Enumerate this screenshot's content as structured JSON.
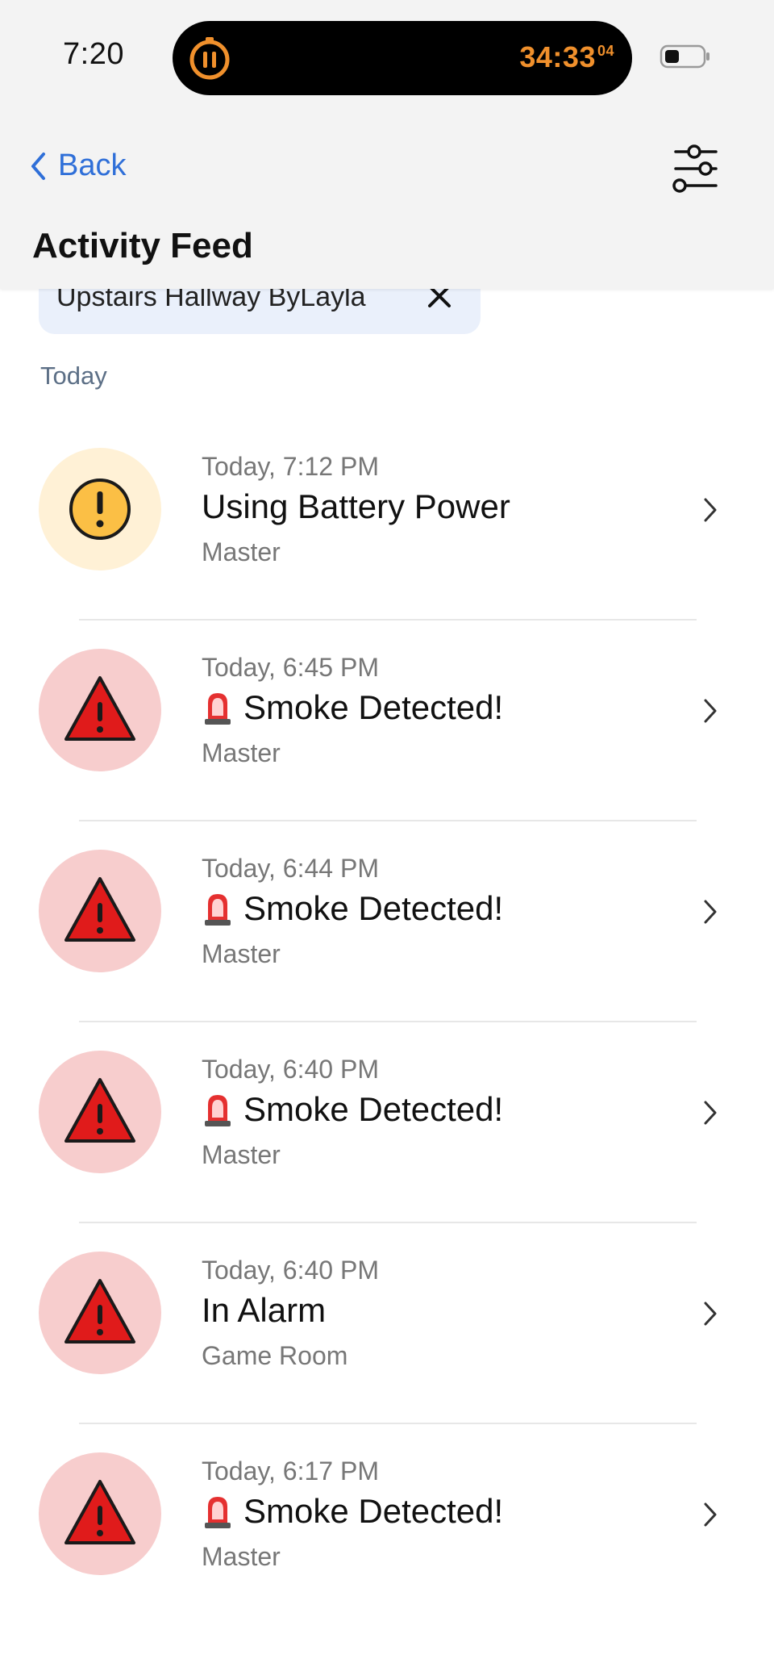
{
  "status_bar": {
    "time": "7:20",
    "timer": "34:33",
    "timer_fraction": "04",
    "timer_color": "#f0902c"
  },
  "nav": {
    "back_label": "Back",
    "filter_icon": "sliders-icon",
    "accent_color": "#2f6fd8"
  },
  "page": {
    "title": "Activity Feed"
  },
  "filter_chip": {
    "label": "Upstairs Hallway ByLayla"
  },
  "section": {
    "label": "Today"
  },
  "items": [
    {
      "time": "Today, 7:12 PM",
      "title": "Using Battery Power",
      "location": "Master",
      "kind": "warning",
      "icon": "exclamation-circle-icon",
      "siren": false
    },
    {
      "time": "Today, 6:45 PM",
      "title": "Smoke Detected!",
      "location": "Master",
      "kind": "alarm",
      "icon": "warning-triangle-icon",
      "siren": true
    },
    {
      "time": "Today, 6:44 PM",
      "title": "Smoke Detected!",
      "location": "Master",
      "kind": "alarm",
      "icon": "warning-triangle-icon",
      "siren": true
    },
    {
      "time": "Today, 6:40 PM",
      "title": "Smoke Detected!",
      "location": "Master",
      "kind": "alarm",
      "icon": "warning-triangle-icon",
      "siren": true
    },
    {
      "time": "Today, 6:40 PM",
      "title": "In Alarm",
      "location": "Game Room",
      "kind": "alarm",
      "icon": "warning-triangle-icon",
      "siren": false
    },
    {
      "time": "Today, 6:17 PM",
      "title": "Smoke Detected!",
      "location": "Master",
      "kind": "alarm",
      "icon": "warning-triangle-icon",
      "siren": true
    }
  ]
}
